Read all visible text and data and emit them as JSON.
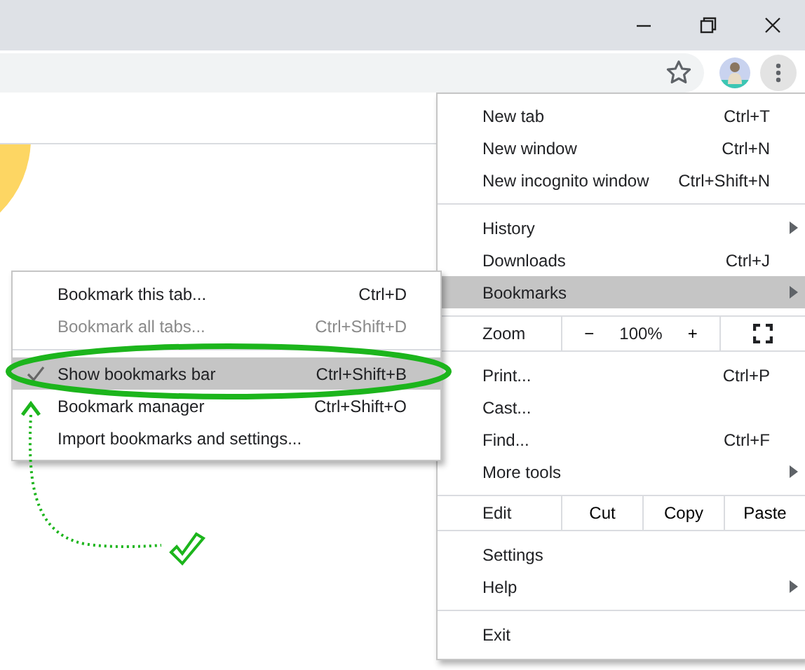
{
  "toolbar": {
    "bookmark_star": {
      "filled": false
    }
  },
  "menu": {
    "sections": [
      [
        {
          "kind": "item",
          "label": "New tab",
          "shortcut": "Ctrl+T",
          "submenu": false,
          "selected": false
        },
        {
          "kind": "item",
          "label": "New window",
          "shortcut": "Ctrl+N",
          "submenu": false,
          "selected": false
        },
        {
          "kind": "item",
          "label": "New incognito window",
          "shortcut": "Ctrl+Shift+N",
          "submenu": false,
          "selected": false
        }
      ],
      [
        {
          "kind": "item",
          "label": "History",
          "submenu": true,
          "selected": false
        },
        {
          "kind": "item",
          "label": "Downloads",
          "shortcut": "Ctrl+J",
          "submenu": false,
          "selected": false
        },
        {
          "kind": "item",
          "label": "Bookmarks",
          "submenu": true,
          "selected": true
        }
      ],
      [
        {
          "kind": "zoom",
          "label": "Zoom",
          "minus": "−",
          "value": "100%",
          "plus": "+",
          "selected": false
        }
      ],
      [
        {
          "kind": "item",
          "label": "Print...",
          "shortcut": "Ctrl+P",
          "submenu": false,
          "selected": false
        },
        {
          "kind": "item",
          "label": "Cast...",
          "submenu": false,
          "selected": false
        },
        {
          "kind": "item",
          "label": "Find...",
          "shortcut": "Ctrl+F",
          "submenu": false,
          "selected": false
        },
        {
          "kind": "item",
          "label": "More tools",
          "submenu": true,
          "selected": false
        }
      ],
      [
        {
          "kind": "edit",
          "label": "Edit",
          "actions": [
            "Cut",
            "Copy",
            "Paste"
          ],
          "selected": false
        }
      ],
      [
        {
          "kind": "item",
          "label": "Settings",
          "submenu": false,
          "selected": false
        },
        {
          "kind": "item",
          "label": "Help",
          "submenu": true,
          "selected": false
        }
      ],
      [
        {
          "kind": "item",
          "label": "Exit",
          "submenu": false,
          "selected": false
        }
      ]
    ]
  },
  "bookmarks_submenu": {
    "sections": [
      [
        {
          "label": "Bookmark this tab...",
          "shortcut": "Ctrl+D",
          "disabled": false,
          "checked": false,
          "selected": false
        },
        {
          "label": "Bookmark all tabs...",
          "shortcut": "Ctrl+Shift+D",
          "disabled": true,
          "checked": false,
          "selected": false
        }
      ],
      [
        {
          "label": "Show bookmarks bar",
          "shortcut": "Ctrl+Shift+B",
          "disabled": false,
          "checked": true,
          "selected": true
        },
        {
          "label": "Bookmark manager",
          "shortcut": "Ctrl+Shift+O",
          "disabled": false,
          "checked": false,
          "selected": false
        },
        {
          "label": "Import bookmarks and settings...",
          "disabled": false,
          "checked": false,
          "selected": false
        }
      ]
    ]
  }
}
